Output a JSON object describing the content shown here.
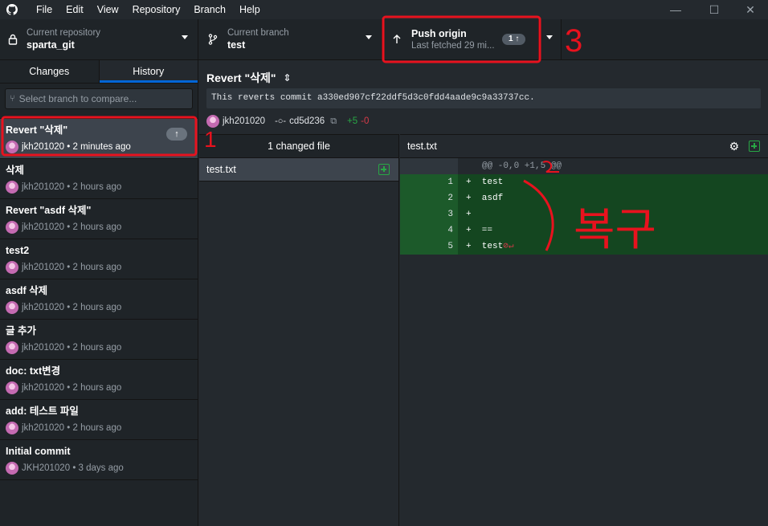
{
  "app": {
    "menu": [
      "File",
      "Edit",
      "View",
      "Repository",
      "Branch",
      "Help"
    ],
    "window_controls": [
      "minimize-icon",
      "maximize-icon",
      "close-icon"
    ]
  },
  "toolbar": {
    "repo_label": "Current repository",
    "repo_name": "sparta_git",
    "branch_label": "Current branch",
    "branch_name": "test",
    "push_title": "Push origin",
    "push_sub": "Last fetched 29 mi...",
    "push_count": "1 ↑"
  },
  "sidebar": {
    "tabs": [
      "Changes",
      "History"
    ],
    "active_tab": "History",
    "compare_placeholder": "Select branch to compare...",
    "commits": [
      {
        "summary": "Revert \"삭제\"",
        "author": "jkh201020",
        "time": "• 2 minutes ago",
        "unpushed": "↑"
      },
      {
        "summary": "삭제",
        "author": "jkh201020",
        "time": "• 2 hours ago"
      },
      {
        "summary": "Revert \"asdf 삭제\"",
        "author": "jkh201020",
        "time": "• 2 hours ago"
      },
      {
        "summary": "test2",
        "author": "jkh201020",
        "time": "• 2 hours ago"
      },
      {
        "summary": "asdf 삭제",
        "author": "jkh201020",
        "time": "• 2 hours ago"
      },
      {
        "summary": "글 추가",
        "author": "jkh201020",
        "time": "• 2 hours ago"
      },
      {
        "summary": "doc: txt변경",
        "author": "jkh201020",
        "time": "• 2 hours ago"
      },
      {
        "summary": "add: 테스트 파일",
        "author": "jkh201020",
        "time": "• 2 hours ago"
      },
      {
        "summary": "Initial commit",
        "author": "JKH201020",
        "time": "• 3 days ago"
      }
    ]
  },
  "commit": {
    "title": "Revert \"삭제\"",
    "description": "This reverts commit a330ed907cf22ddf5d3c0fdd4aade9c9a33737cc.",
    "author": "jkh201020",
    "sha": "cd5d236",
    "additions": "+5",
    "deletions": "-0"
  },
  "files": {
    "header": "1 changed file",
    "list": [
      "test.txt"
    ]
  },
  "diff": {
    "file": "test.txt",
    "hunk": "@@ -0,0 +1,5 @@",
    "lines": [
      {
        "num": "1",
        "text": "+  test"
      },
      {
        "num": "2",
        "text": "+  asdf"
      },
      {
        "num": "3",
        "text": "+"
      },
      {
        "num": "4",
        "text": "+  =="
      },
      {
        "num": "5",
        "text": "+  test"
      }
    ],
    "no_eol": "⊘↵"
  },
  "annotations": {
    "color": "#e8121e",
    "marks": [
      "1",
      "2",
      "3",
      "복구"
    ]
  }
}
